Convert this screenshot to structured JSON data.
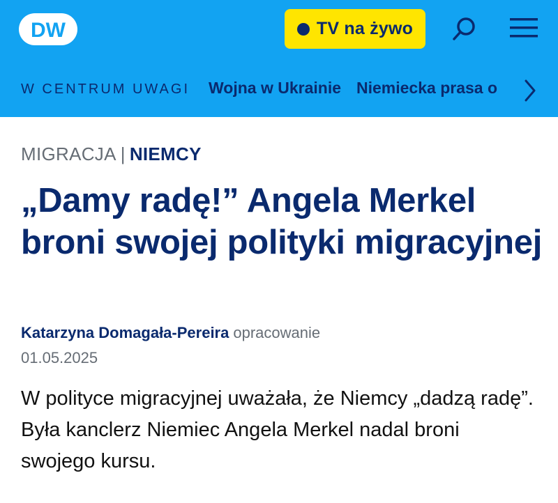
{
  "header": {
    "logo_text": "DW",
    "live_button_label": "TV na żywo",
    "colors": {
      "background": "#12a3f2",
      "live_button": "#ffe500",
      "brand_dark": "#0a2a6e"
    },
    "icons": {
      "search": "search-icon",
      "menu": "hamburger-menu-icon",
      "next": "chevron-right-icon"
    }
  },
  "spotlight": {
    "label": "W CENTRUM UWAGI",
    "links": [
      "Wojna w Ukrainie",
      "Niemiecka prasa o"
    ]
  },
  "article": {
    "breadcrumb": {
      "category": "MIGRACJA",
      "separator": "|",
      "subcategory": "NIEMCY"
    },
    "headline": "„Damy radę!” Angela Merkel broni swojej polityki migracyjnej",
    "author": "Katarzyna Domagała-Pereira",
    "author_role": "opracowanie",
    "date": "01.05.2025",
    "lead": "W polityce migracyjnej uważała, że Niemcy „dadzą radę”. Była kanclerz Niemiec Angela Merkel nadal broni swojego kursu."
  }
}
